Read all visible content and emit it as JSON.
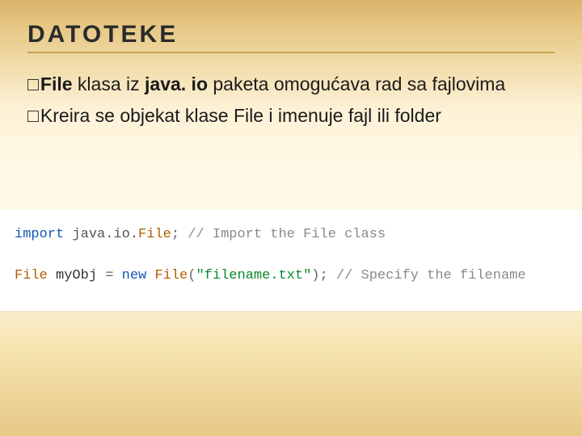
{
  "title": "DATOTEKE",
  "bullets": [
    {
      "square": "□",
      "bold": "File",
      "rest1": " klasa iz ",
      "bold2": "java. io",
      "rest2": " paketa omogućava rad sa fajlovima"
    },
    {
      "square": "□",
      "bold": "",
      "rest1": "Kreira se objekat klase File i imenuje fajl ili folder",
      "bold2": "",
      "rest2": ""
    }
  ],
  "code": {
    "l1": {
      "kw": "import",
      "pkg": " java.io.",
      "cls": "File",
      "semi": "; ",
      "cmt": "  // Import the File class"
    },
    "l2": {
      "cls": "File",
      "var": " myObj ",
      "op": "= ",
      "kw": "new ",
      "cls2": "File",
      "paren_open": "(",
      "str": "\"filename.txt\"",
      "paren_close": ");",
      "cmt": " // Specify the filename"
    }
  }
}
